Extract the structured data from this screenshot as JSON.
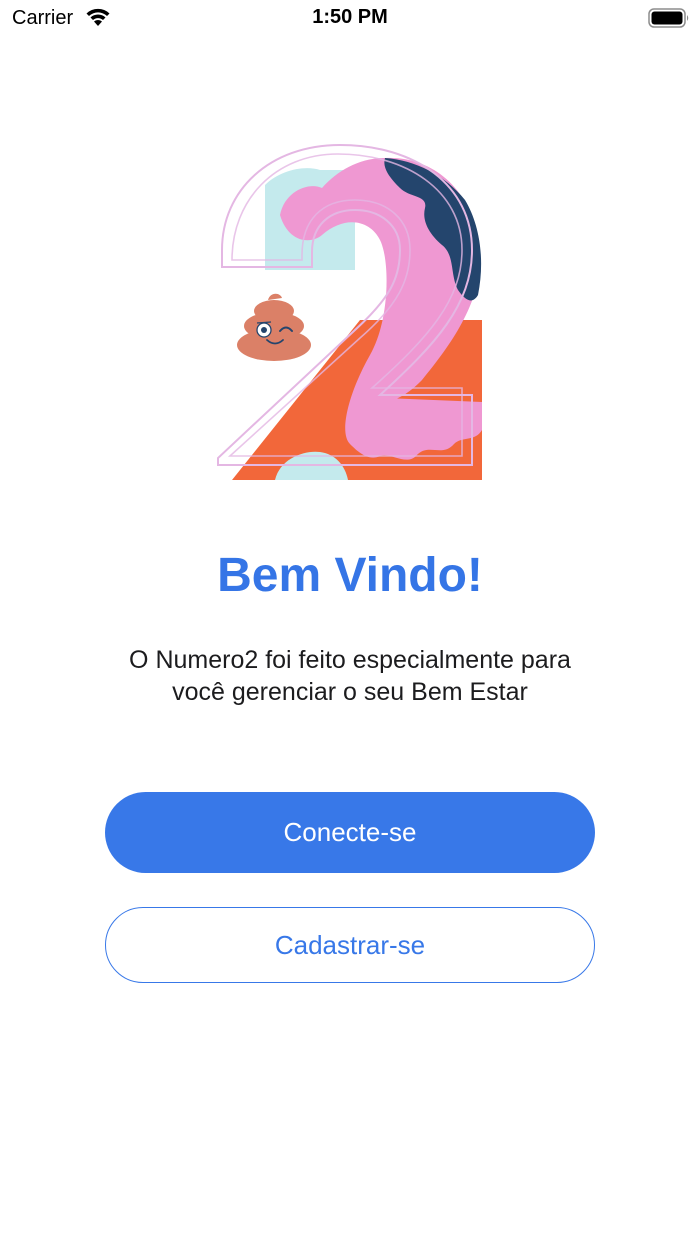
{
  "status_bar": {
    "carrier": "Carrier",
    "time": "1:50 PM",
    "icons": [
      "wifi-icon",
      "battery-icon"
    ]
  },
  "illustration": {
    "icon": "number-two-poop-logo",
    "colors": {
      "pink": "#ef98d2",
      "light_blue": "#c4eaed",
      "navy": "#24456d",
      "orange": "#f2673a",
      "outline": "#e4b7e3",
      "poop": "#db8067"
    }
  },
  "welcome": {
    "title": "Bem Vindo!",
    "line1": "O Numero2 foi feito especialmente para",
    "line2": "você gerenciar o seu Bem Estar"
  },
  "buttons": {
    "login_label": "Conecte-se",
    "signup_label": "Cadastrar-se"
  },
  "theme": {
    "accent": "#3878e8",
    "title_color": "#3575e6"
  }
}
